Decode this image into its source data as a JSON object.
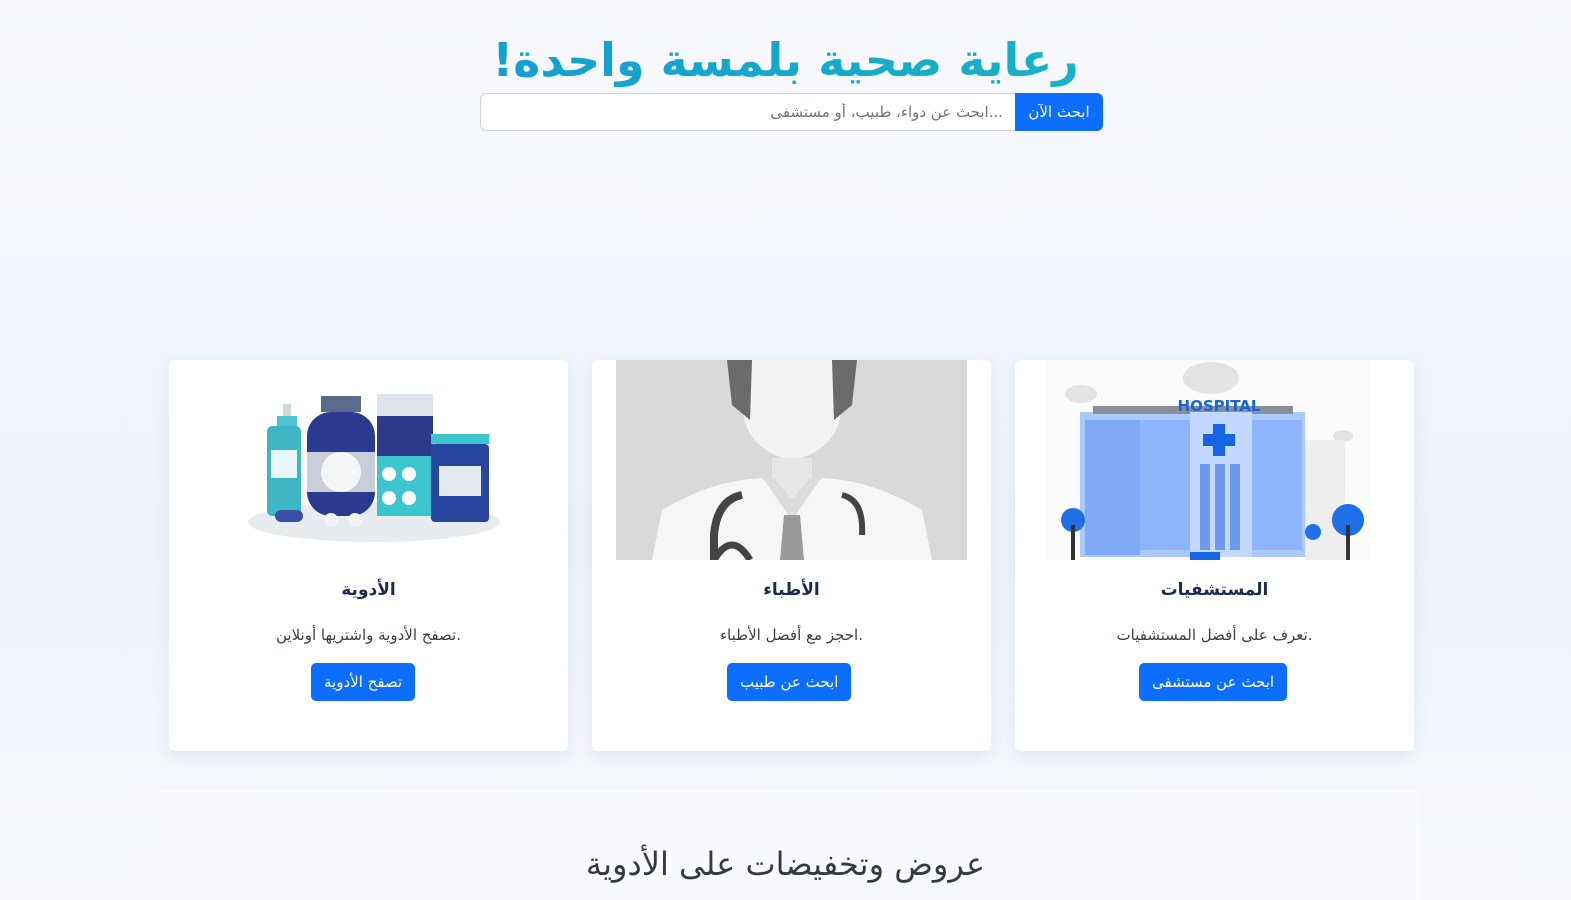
{
  "hero": {
    "title": "!رعاية صحية بلمسة واحدة",
    "search_placeholder": "...ابحث عن دواء، طبيب، أو مستشفى",
    "search_button": "ابحث الآن"
  },
  "cards": [
    {
      "title": "المستشفيات",
      "description": ".تعرف على أفضل المستشفيات",
      "button": "ابحث عن مستشفى",
      "image_text": "HOSPITAL",
      "icon": "hospital-illustration"
    },
    {
      "title": "الأطباء",
      "description": ".احجز مع أفضل الأطباء",
      "button": "ابحث عن طبيب",
      "icon": "doctor-silhouette"
    },
    {
      "title": "الأدوية",
      "description": ".تصفح الأدوية واشتريها أونلاين",
      "button": "تصفح الأدوية",
      "icon": "medicine-bottles"
    }
  ],
  "offers": {
    "title": "عروض وتخفيضات على الأدوية"
  },
  "colors": {
    "primary": "#0d6efd",
    "title_gradient_start": "#0d8fe0",
    "title_gradient_end": "#1ec2b8"
  }
}
